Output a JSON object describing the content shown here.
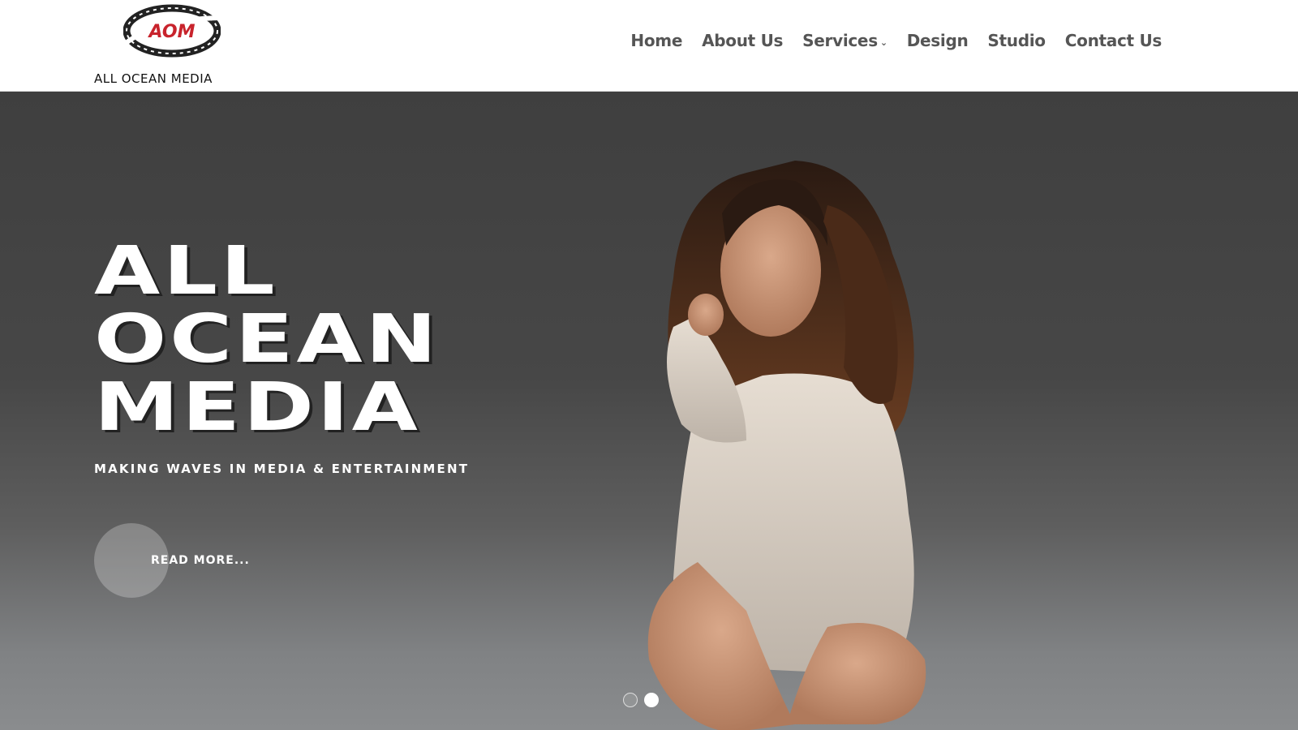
{
  "brand": {
    "logo_mark_text": "AOM",
    "name": "ALL OCEAN MEDIA"
  },
  "nav": {
    "items": [
      {
        "label": "Home"
      },
      {
        "label": "About Us"
      },
      {
        "label": "Services",
        "has_dropdown": true
      },
      {
        "label": "Design"
      },
      {
        "label": "Studio"
      },
      {
        "label": "Contact Us"
      }
    ]
  },
  "hero": {
    "title_lines": [
      "ALL",
      "OCEAN",
      "MEDIA"
    ],
    "tagline": "MAKING WAVES IN MEDIA & ENTERTAINMENT",
    "cta_label": "READ MORE...",
    "slides": {
      "count": 2,
      "active_index": 2
    }
  },
  "colors": {
    "logo_red": "#c8232c",
    "nav_text": "#555555",
    "hero_text": "#ffffff"
  }
}
